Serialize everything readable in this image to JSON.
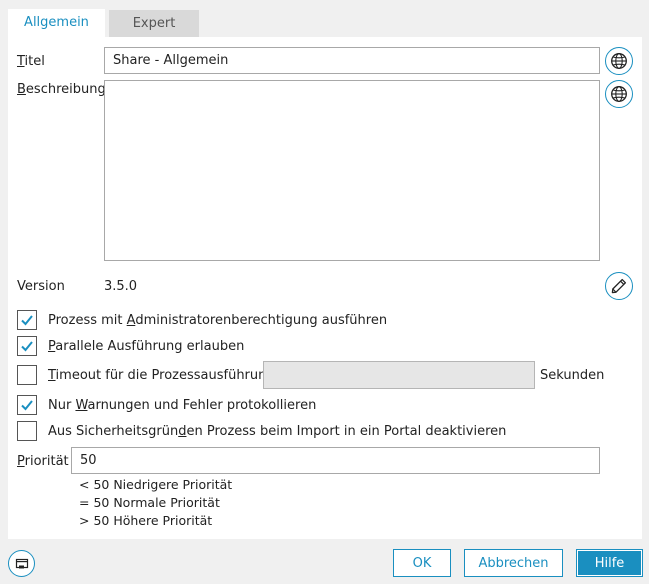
{
  "tabs": [
    {
      "label": "Allgemein",
      "active": true
    },
    {
      "label": "Expert",
      "active": false
    }
  ],
  "form": {
    "title_label": "Titel",
    "title_underline": "T",
    "title_rest": "itel",
    "title_value": "Share - Allgemein",
    "description_label_u": "B",
    "description_label_rest": "eschreibung",
    "description_value": "",
    "version_label": "Version",
    "version_value": "3.5.0",
    "checkboxes": [
      {
        "pre": "Prozess mit ",
        "u": "A",
        "post": "dministratorenberechtigung ausführen",
        "checked": true
      },
      {
        "pre": "",
        "u": "P",
        "post": "arallele Ausführung erlauben",
        "checked": true
      },
      {
        "pre": "",
        "u": "T",
        "post": "imeout für die Prozessausführung",
        "checked": false
      },
      {
        "pre": "Nur ",
        "u": "W",
        "post": "arnungen und Fehler protokollieren",
        "checked": true
      },
      {
        "pre": "Aus Sicherheitsgrün",
        "u": "d",
        "post": "en Prozess beim Import in ein Portal deaktivieren",
        "checked": false
      }
    ],
    "timeout_value": "",
    "timeout_unit": "Sekunden",
    "priority_label_u": "P",
    "priority_label_rest": "riorität",
    "priority_value": "50",
    "priority_hints": [
      "< 50 Niedrigere Priorität",
      "= 50 Normale Priorität",
      "> 50 Höhere Priorität"
    ]
  },
  "buttons": {
    "ok": "OK",
    "cancel": "Abbrechen",
    "help": "Hilfe"
  },
  "icons": {
    "translate": "globe-icon",
    "edit": "pencil-icon",
    "window": "window-icon"
  },
  "colors": {
    "accent": "#1a8fc0"
  }
}
